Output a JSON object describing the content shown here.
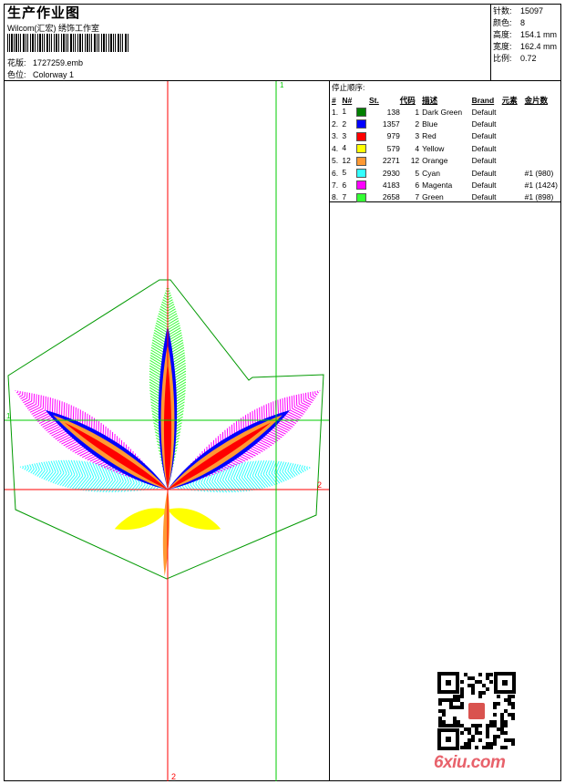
{
  "header": {
    "title": "生产作业图",
    "company": "Wilcom(汇宏) 绣饰工作室",
    "pattern_label": "花版:",
    "pattern_value": "1727259.emb",
    "colorway_label": "色位:",
    "colorway_value": "Colorway 1"
  },
  "stats": [
    {
      "label": "针数:",
      "value": "15097"
    },
    {
      "label": "颜色:",
      "value": "8"
    },
    {
      "label": "高度:",
      "value": "154.1 mm"
    },
    {
      "label": "宽度:",
      "value": "162.4 mm"
    },
    {
      "label": "比例:",
      "value": "0.72"
    }
  ],
  "sequence": {
    "title": "停止顺序:",
    "columns": [
      "#",
      "N#",
      "St.",
      "代码",
      "描述",
      "Brand",
      "元素",
      "金片数"
    ],
    "rows": [
      {
        "num": "1.",
        "n": "1",
        "color": "#008000",
        "st": "138",
        "code": "1",
        "desc": "Dark Green",
        "brand": "Default",
        "elem": ""
      },
      {
        "num": "2.",
        "n": "2",
        "color": "#0000ff",
        "st": "1357",
        "code": "2",
        "desc": "Blue",
        "brand": "Default",
        "elem": ""
      },
      {
        "num": "3.",
        "n": "3",
        "color": "#ff0000",
        "st": "979",
        "code": "3",
        "desc": "Red",
        "brand": "Default",
        "elem": ""
      },
      {
        "num": "4.",
        "n": "4",
        "color": "#ffff00",
        "st": "579",
        "code": "4",
        "desc": "Yellow",
        "brand": "Default",
        "elem": ""
      },
      {
        "num": "5.",
        "n": "12",
        "color": "#ff9933",
        "st": "2271",
        "code": "12",
        "desc": "Orange",
        "brand": "Default",
        "elem": ""
      },
      {
        "num": "6.",
        "n": "5",
        "color": "#33ffff",
        "st": "2930",
        "code": "5",
        "desc": "Cyan",
        "brand": "Default",
        "elem": "#1 (980)"
      },
      {
        "num": "7.",
        "n": "6",
        "color": "#ff00ff",
        "st": "4183",
        "code": "6",
        "desc": "Magenta",
        "brand": "Default",
        "elem": "#1 (1424)"
      },
      {
        "num": "8.",
        "n": "7",
        "color": "#33ff33",
        "st": "2658",
        "code": "7",
        "desc": "Green",
        "brand": "Default",
        "elem": "#1 (898)"
      }
    ]
  },
  "guides": {
    "green_v_label": "1",
    "green_h_label": "1",
    "red_h_label": "2",
    "red_v_label": "2"
  },
  "colors": {
    "guide_red": "#ff0000",
    "guide_green": "#00cc00",
    "outline_green": "#009900"
  },
  "watermark": "6xiu.com"
}
